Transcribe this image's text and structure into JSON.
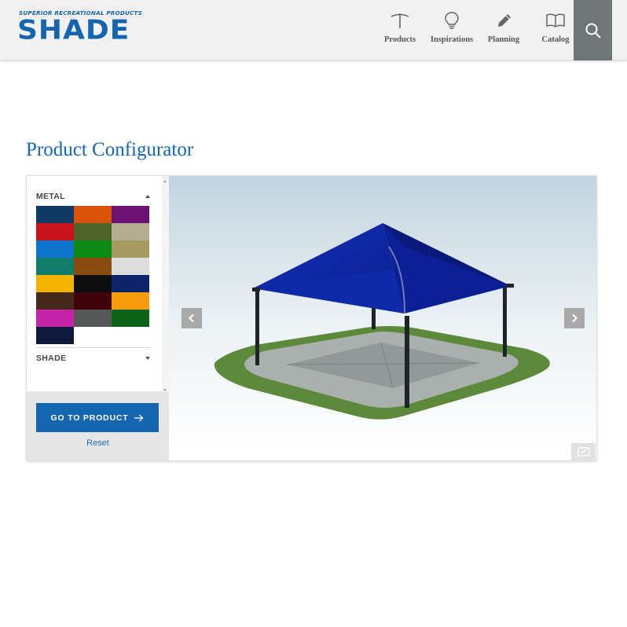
{
  "brand": {
    "tagline": "SUPERIOR RECREATIONAL PRODUCTS",
    "logo": "SHADE",
    "color": "#1566b0"
  },
  "nav": [
    {
      "label": "Products",
      "icon": "umbrella-icon"
    },
    {
      "label": "Inspirations",
      "icon": "lightbulb-icon"
    },
    {
      "label": "Planning",
      "icon": "pencil-icon"
    },
    {
      "label": "Catalog",
      "icon": "book-icon"
    }
  ],
  "search": {
    "icon": "search-icon"
  },
  "page": {
    "title": "Product Configurator"
  },
  "configurator": {
    "sections": {
      "metal": {
        "label": "METAL",
        "state": "expanded"
      },
      "shade": {
        "label": "SHADE",
        "state": "collapsed"
      }
    },
    "metal_colors": [
      "#0f3a63",
      "#d9540a",
      "#6a1373",
      "#c8141a",
      "#4e6428",
      "#b3ad92",
      "#1074cf",
      "#0a8c12",
      "#a69a5e",
      "#107c6a",
      "#8a4c10",
      "#dcdcdc",
      "#f3b300",
      "#0e0e0e",
      "#0c2469",
      "#47291b",
      "#3e0409",
      "#f89c0d",
      "#c624a8",
      "#565858",
      "#0d6419",
      "#0d1a3e"
    ],
    "go_button": "GO TO PRODUCT",
    "reset": "Reset",
    "viewer": {
      "prev_icon": "chevron-left-icon",
      "next_icon": "chevron-right-icon",
      "fullscreen_icon": "fullscreen-icon",
      "canopy_color": "#0c22a6",
      "ground_color": "#5c8a3a",
      "pad_color": "#a9b0ae"
    }
  }
}
